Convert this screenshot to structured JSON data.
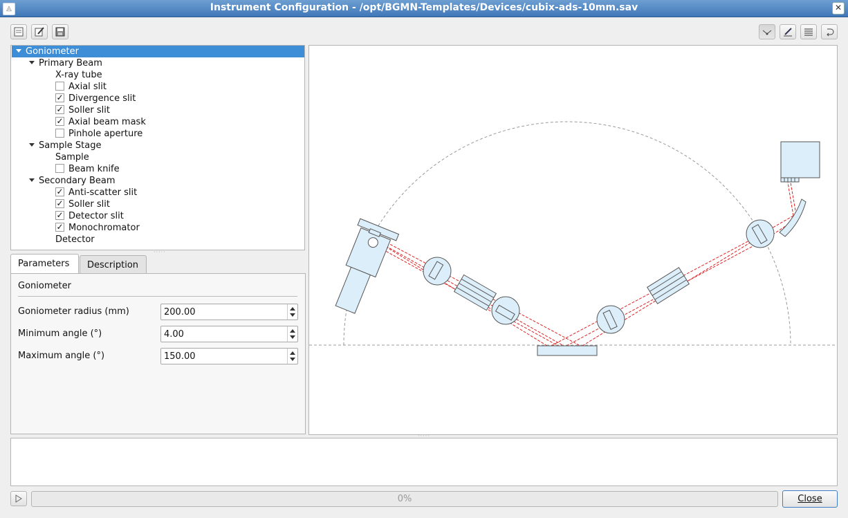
{
  "window": {
    "title": "Instrument Configuration - /opt/BGMN-Templates/Devices/cubix-ads-10mm.sav"
  },
  "toolbar": {
    "left": [
      "new-file-icon",
      "edit-file-icon",
      "save-icon"
    ],
    "right": [
      "beam-view-icon",
      "annotate-icon",
      "list-icon",
      "reset-icon"
    ]
  },
  "tree": {
    "root": "Goniometer",
    "primary_beam": "Primary Beam",
    "xray_tube": "X-ray tube",
    "axial_slit": "Axial slit",
    "divergence_slit": "Divergence slit",
    "soller_slit_1": "Soller slit",
    "axial_beam_mask": "Axial beam mask",
    "pinhole_aperture": "Pinhole aperture",
    "sample_stage": "Sample Stage",
    "sample": "Sample",
    "beam_knife": "Beam knife",
    "secondary_beam": "Secondary Beam",
    "anti_scatter_slit": "Anti-scatter slit",
    "soller_slit_2": "Soller slit",
    "detector_slit": "Detector slit",
    "monochromator": "Monochromator",
    "detector": "Detector",
    "checked": {
      "axial_slit": false,
      "divergence_slit": true,
      "soller_slit_1": true,
      "axial_beam_mask": true,
      "pinhole_aperture": false,
      "beam_knife": false,
      "anti_scatter_slit": true,
      "soller_slit_2": true,
      "detector_slit": true,
      "monochromator": true
    },
    "check_mark": "✓"
  },
  "tabs": {
    "parameters": "Parameters",
    "description": "Description"
  },
  "params": {
    "section": "Goniometer",
    "radius_label": "Goniometer radius (mm)",
    "radius_value": "200.00",
    "min_label": "Minimum angle (°)",
    "min_value": "4.00",
    "max_label": "Maximum angle (°)",
    "max_value": "150.00"
  },
  "footer": {
    "progress": "0%",
    "close": "Close"
  },
  "colors": {
    "selection": "#3d8ed6",
    "beam": "#dd2222",
    "component_fill": "#dceef9"
  }
}
